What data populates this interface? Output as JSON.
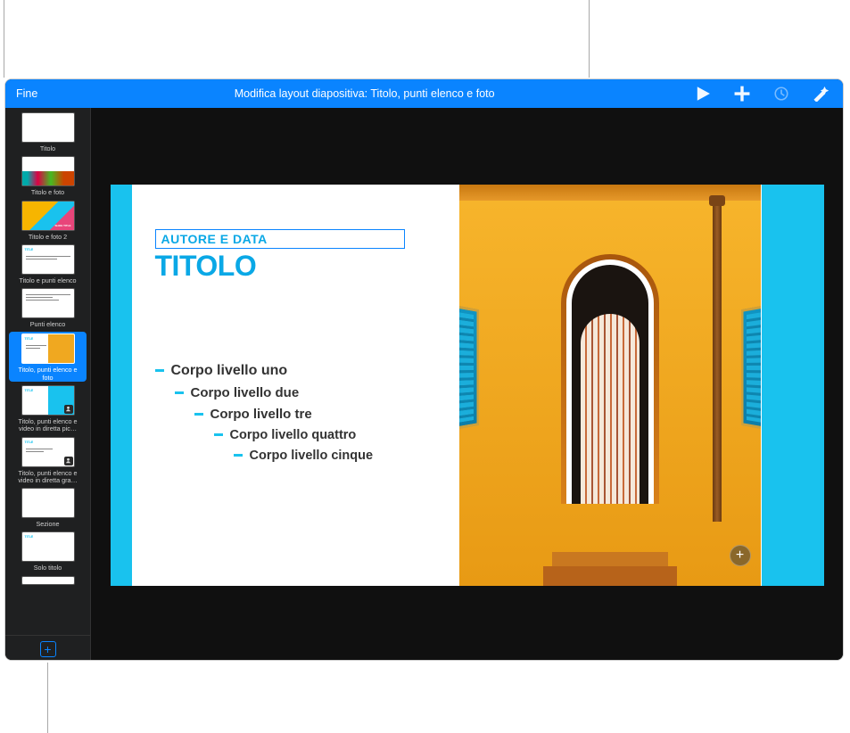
{
  "toolbar": {
    "done_label": "Fine",
    "title": "Modifica layout diapositiva: Titolo, punti elenco e foto",
    "icons": {
      "play": "play-icon",
      "add": "plus-icon",
      "sync": "arrow-circle-icon",
      "animate": "wand-icon"
    }
  },
  "sidebar": {
    "items": [
      {
        "label": "Titolo"
      },
      {
        "label": "Titolo e foto"
      },
      {
        "label": "Titolo e foto 2"
      },
      {
        "label": "Titolo e punti elenco"
      },
      {
        "label": "Punti elenco"
      },
      {
        "label": "Titolo, punti elenco e foto"
      },
      {
        "label": "Titolo, punti elenco e video in diretta pic…"
      },
      {
        "label": "Titolo, punti elenco e video in diretta gra…"
      },
      {
        "label": "Sezione"
      },
      {
        "label": "Solo titolo"
      }
    ],
    "selected_index": 5,
    "add_slide_icon": "plus-icon"
  },
  "slide": {
    "author_placeholder": "AUTORE E DATA",
    "title_placeholder": "TITOLO",
    "bullets": [
      {
        "level": 1,
        "text": "Corpo livello uno"
      },
      {
        "level": 2,
        "text": "Corpo livello due"
      },
      {
        "level": 3,
        "text": "Corpo livello tre"
      },
      {
        "level": 4,
        "text": "Corpo livello quattro"
      },
      {
        "level": 5,
        "text": "Corpo livello cinque"
      }
    ],
    "image_add_icon": "plus-icon"
  },
  "colors": {
    "accent": "#0a84ff",
    "slide_bg": "#19c2ee",
    "wall": "#f0a820"
  }
}
